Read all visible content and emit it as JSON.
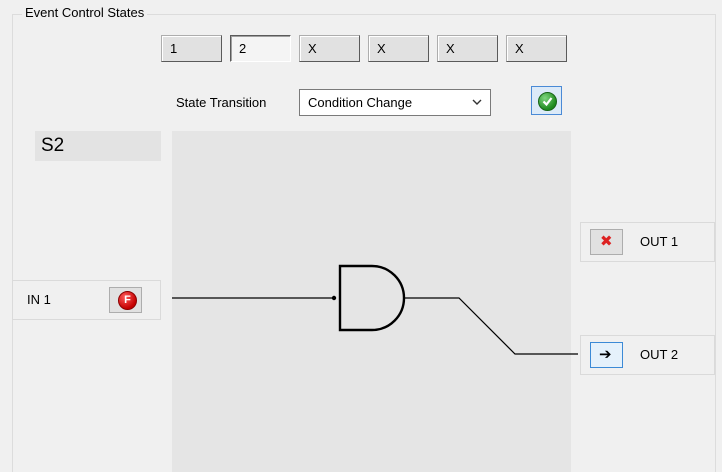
{
  "group": {
    "title": "Event Control States"
  },
  "tabs": [
    {
      "label": "1",
      "active": false
    },
    {
      "label": "2",
      "active": true
    },
    {
      "label": "X",
      "active": false
    },
    {
      "label": "X",
      "active": false
    },
    {
      "label": "X",
      "active": false
    },
    {
      "label": "X",
      "active": false
    }
  ],
  "state_transition": {
    "label": "State Transition",
    "selected": "Condition Change"
  },
  "state_name": "S2",
  "input": {
    "label": "IN 1",
    "button_glyph": "F",
    "icon": "false-icon"
  },
  "outputs": [
    {
      "label": "OUT 1",
      "icon": "cross-icon"
    },
    {
      "label": "OUT 2",
      "icon": "arrow-right-icon"
    }
  ],
  "colors": {
    "apply_green": "#1e8a1e",
    "input_red": "#c40000",
    "cross_red": "#dd2222",
    "focus_blue": "#3c8ad6"
  }
}
